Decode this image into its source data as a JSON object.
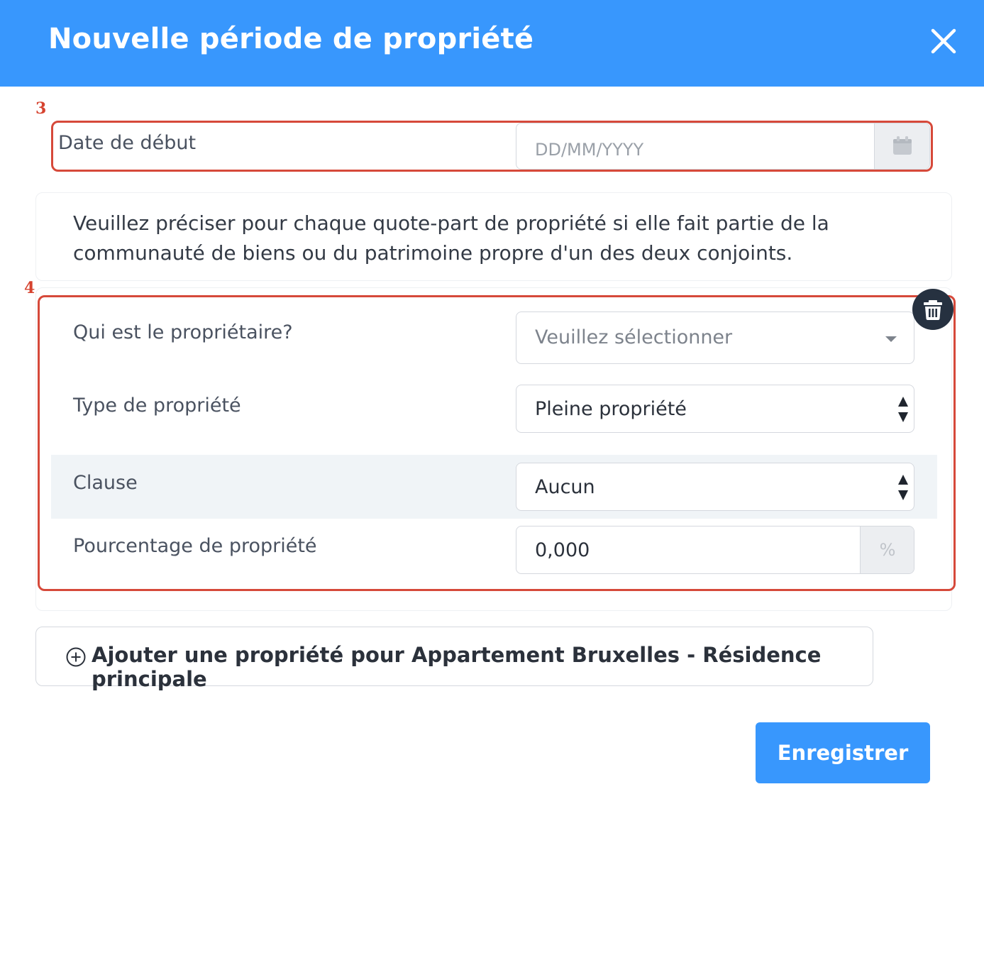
{
  "header": {
    "title": "Nouvelle période de propriété",
    "close_icon": "close-icon"
  },
  "annotations": {
    "marker_3": "3",
    "marker_4": "4",
    "highlight_color": "#d6493a"
  },
  "start_date": {
    "label": "Date de début",
    "placeholder": "DD/MM/YYYY",
    "value": "",
    "addon_icon": "calendar-icon"
  },
  "info": {
    "text": "Veuillez préciser pour chaque quote-part de propriété si elle fait partie de la communauté de biens ou du patrimoine propre d'un des deux conjoints."
  },
  "ownership": {
    "delete_icon": "trash-icon",
    "owner": {
      "label": "Qui est le propriétaire?",
      "placeholder": "Veuillez sélectionner"
    },
    "property_type": {
      "label": "Type de propriété",
      "selected": "Pleine propriété"
    },
    "clause": {
      "label": "Clause",
      "selected": "Aucun"
    },
    "percentage": {
      "label": "Pourcentage de propriété",
      "value": "0,000",
      "unit": "%"
    }
  },
  "add_button": {
    "label": "Ajouter une propriété pour Appartement Bruxelles - Résidence principale",
    "icon": "plus-circle-icon"
  },
  "save_button": {
    "label": "Enregistrer"
  },
  "colors": {
    "primary": "#3897fd",
    "dark": "#263140"
  }
}
